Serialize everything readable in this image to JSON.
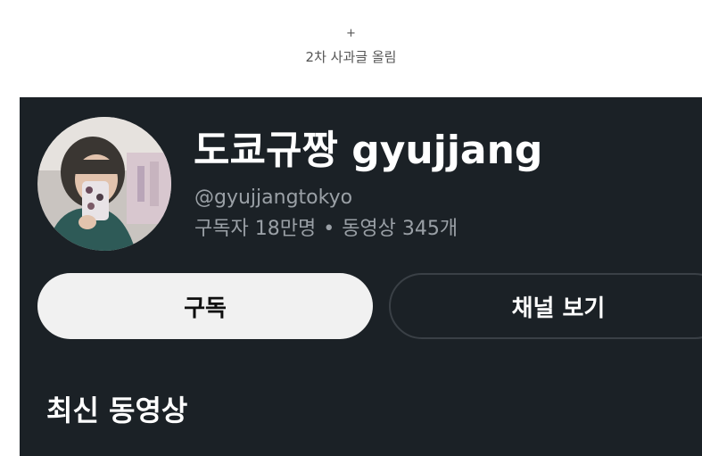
{
  "caption": {
    "plus": "+",
    "text": "2차 사과글 올림"
  },
  "channel": {
    "name": "도쿄규짱 gyujjang",
    "handle": "@gyujjangtokyo",
    "subscribers": "구독자 18만명",
    "separator": "•",
    "videos": "동영상 345개",
    "avatar": "profile-photo"
  },
  "buttons": {
    "subscribe": "구독",
    "view_channel": "채널 보기"
  },
  "sections": {
    "latest_videos": "최신 동영상"
  },
  "colors": {
    "background": "#1b2126",
    "subscribe_bg": "#f1f1f1",
    "secondary_text": "#9aa0a6"
  }
}
